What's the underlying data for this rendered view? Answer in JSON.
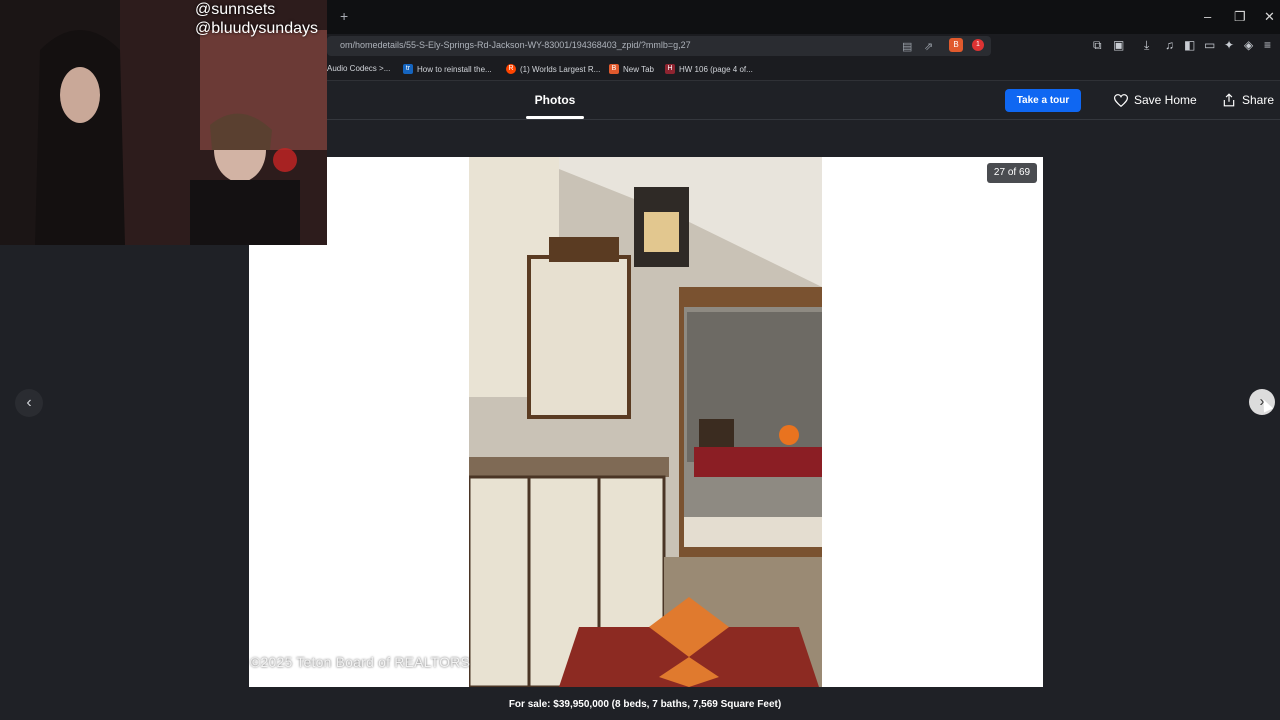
{
  "webcam": {
    "handles": [
      "@sunnsets",
      "@bluudysundays"
    ]
  },
  "browser": {
    "new_tab_glyph": "+",
    "window_controls": {
      "minimize": "–",
      "restore": "❐",
      "close": "✕"
    },
    "url": "om/homedetails/55-S-Ely-Springs-Rd-Jackson-WY-83001/194368403_zpid/?mmlb=g,27",
    "brave_badge": "B",
    "notif_badge": "1",
    "bookmarks": [
      {
        "label": "Audio Codecs >...",
        "icon": ""
      },
      {
        "label": "How to reinstall the...",
        "icon": "tr"
      },
      {
        "label": "(1) Worlds Largest R...",
        "icon": "R"
      },
      {
        "label": "New Tab",
        "icon": "B"
      },
      {
        "label": "HW 106 (page 4 of...",
        "icon": "H"
      }
    ]
  },
  "header": {
    "photos_tab": "Photos",
    "tour_button": "Take a tour",
    "save_home": "Save Home",
    "share": "Share"
  },
  "viewer": {
    "counter": "27 of 69",
    "watermark": "©2025 Teton Board of REALTORS",
    "prev_glyph": "‹",
    "next_glyph": "›",
    "caption": "For sale: $39,950,000 (8 beds, 7 baths, 7,569 Square Feet)"
  },
  "colors": {
    "accent": "#0f67f2",
    "page_bg": "#1f2126"
  }
}
